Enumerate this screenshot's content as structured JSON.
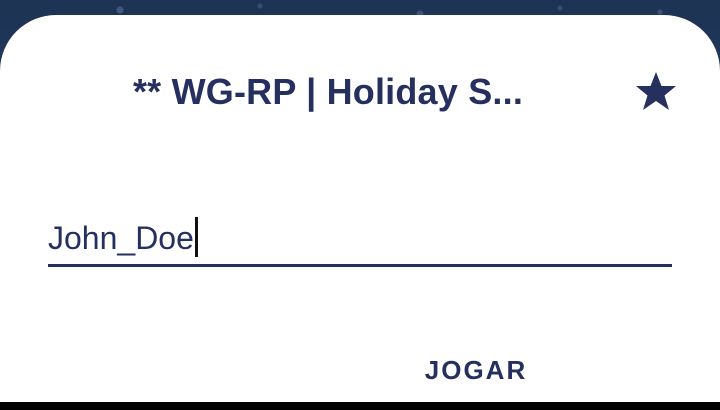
{
  "dialog": {
    "title": "** WG-RP | Holiday S...",
    "favorite_icon": "star-icon",
    "nickname_value": "John_Doe",
    "play_button_label": "JOGAR"
  },
  "colors": {
    "accent": "#26305f",
    "background": "#203a5e",
    "surface": "#ffffff"
  }
}
